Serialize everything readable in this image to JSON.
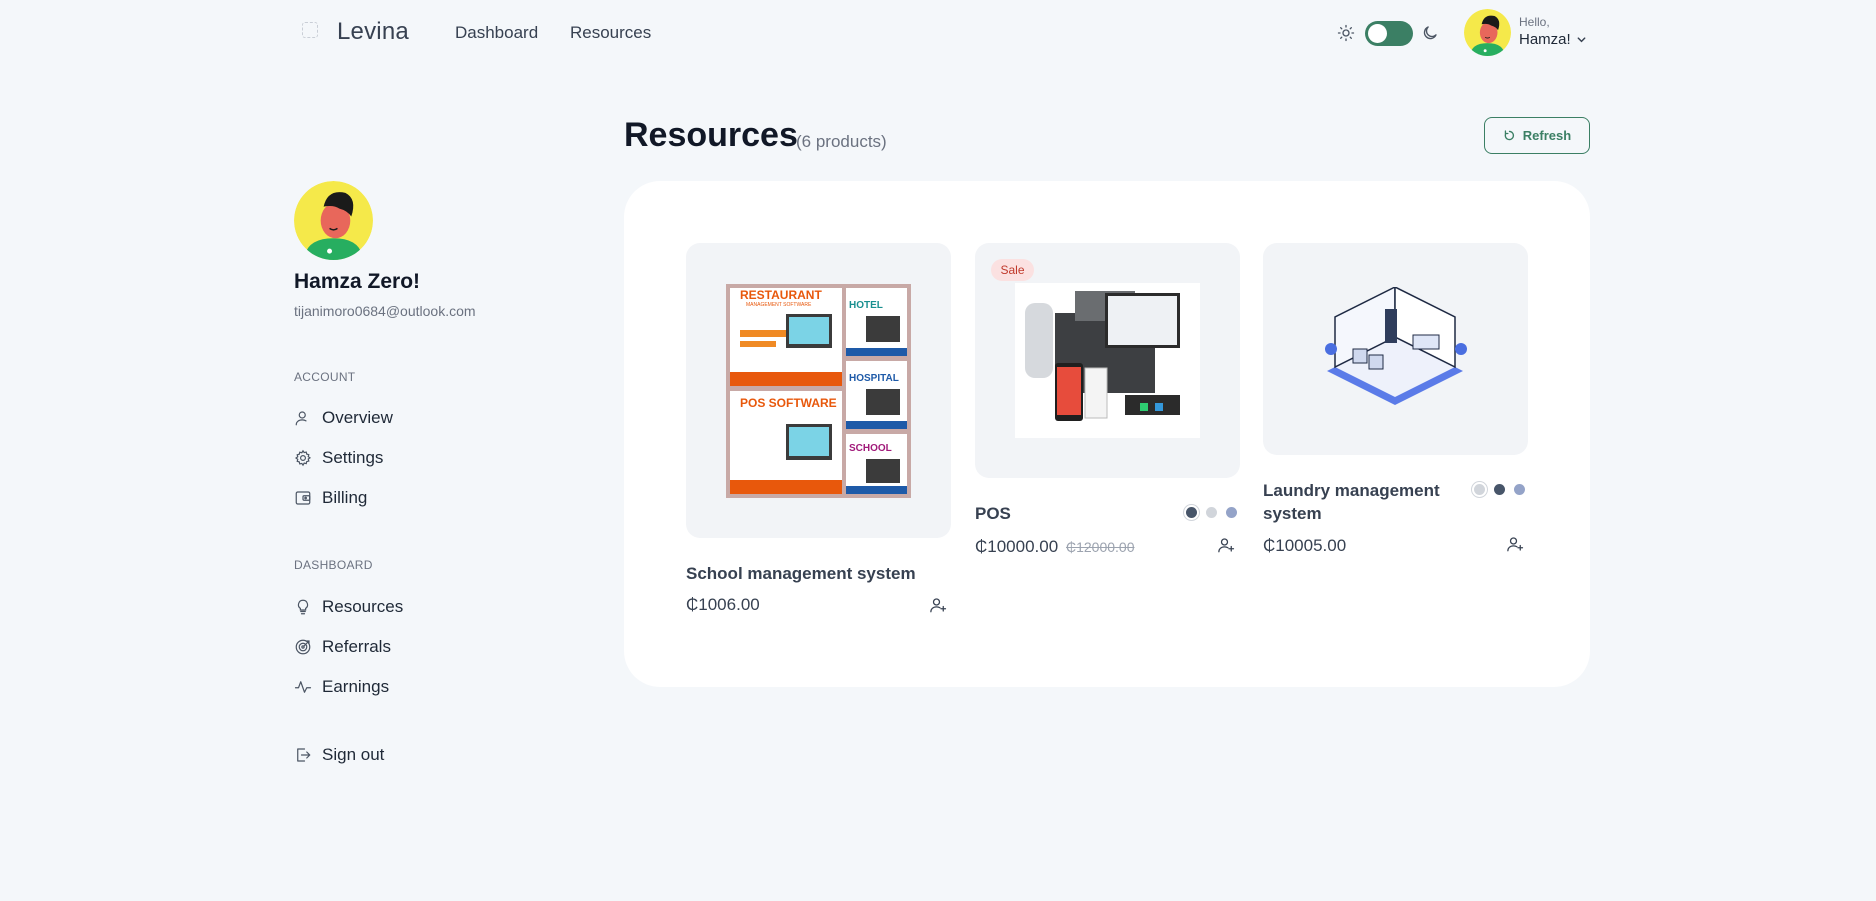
{
  "nav": {
    "logo_text": "Levina",
    "links": [
      "Dashboard",
      "Resources"
    ],
    "hello": "Hello,",
    "user_short": "Hamza!"
  },
  "sidebar": {
    "name": "Hamza Zero!",
    "email": "tijanimoro0684@outlook.com",
    "sections": [
      {
        "label": "ACCOUNT",
        "items": [
          "Overview",
          "Settings",
          "Billing"
        ]
      },
      {
        "label": "DASHBOARD",
        "items": [
          "Resources",
          "Referrals",
          "Earnings"
        ]
      }
    ],
    "sign_out": "Sign out"
  },
  "main": {
    "title": "Resources",
    "count": "(6 products)",
    "refresh_label": "Refresh",
    "products": [
      {
        "name": "School management system",
        "price": "₵1006.00"
      },
      {
        "name": "POS",
        "price": "₵10000.00",
        "old_price": "₵12000.00",
        "badge": "Sale"
      },
      {
        "name": "Laundry management system",
        "price": "₵10005.00"
      }
    ],
    "poster": {
      "top_title": "RESTAURANT",
      "top_sub": "MANAGEMENT SOFTWARE",
      "mid_title": "POS SOFTWARE",
      "side_labels": [
        "HOTEL",
        "HOSPITAL",
        "SCHOOL"
      ]
    }
  },
  "colors": {
    "accent": "#3b7f64",
    "swatches_pos": [
      "#475569",
      "#d1d5db",
      "#94a3c8"
    ],
    "swatches_laundry": [
      "#d1d5db",
      "#475569",
      "#94a3c8"
    ]
  },
  "icons": [
    "sun-icon",
    "moon-icon",
    "chevron-down-icon",
    "user-icon",
    "gear-icon",
    "wallet-icon",
    "lightbulb-icon",
    "target-icon",
    "activity-icon",
    "sign-out-icon",
    "refresh-icon",
    "user-plus-icon"
  ]
}
